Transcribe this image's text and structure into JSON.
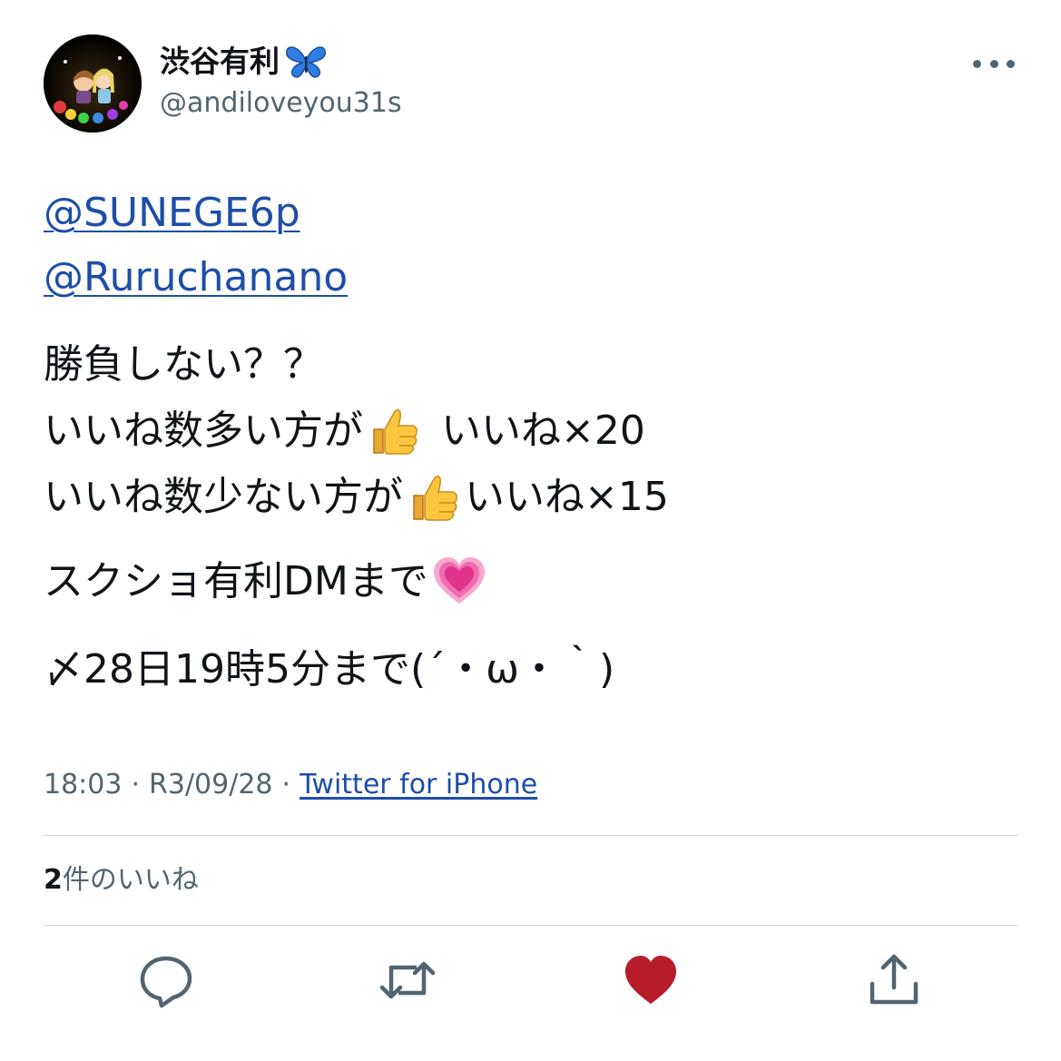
{
  "author": {
    "display_name": "渋谷有利",
    "name_emoji": "butterfly-icon",
    "handle": "@andiloveyou31s"
  },
  "tweet": {
    "mentions": [
      "@SUNEGE6p",
      "@Ruruchanano"
    ],
    "line1": "勝負しない？？",
    "line2_a": "いいね数多い方が",
    "line2_b": "いいね×20",
    "line3_a": "いいね数少ない方が",
    "line3_b": "いいね×15",
    "line4": "スクショ有利DMまで",
    "line5": "〆28日19時5分まで(´・ω・｀)",
    "emojis": [
      "thumbs-up-icon",
      "thumbs-up-icon",
      "growing-heart-icon"
    ]
  },
  "meta": {
    "time": "18:03",
    "separator": "·",
    "date": "R3/09/28",
    "source": "Twitter for iPhone"
  },
  "stats": {
    "likes_count": "2",
    "likes_label": "件のいいね"
  },
  "actions": {
    "reply": "reply-icon",
    "retweet": "retweet-icon",
    "like": "heart-icon",
    "share": "share-icon",
    "liked": true
  },
  "colors": {
    "text": "#0f1419",
    "secondary": "#536471",
    "link": "#1d4ea8",
    "divider": "#cfd9de",
    "like_active": "#b71c2b"
  }
}
